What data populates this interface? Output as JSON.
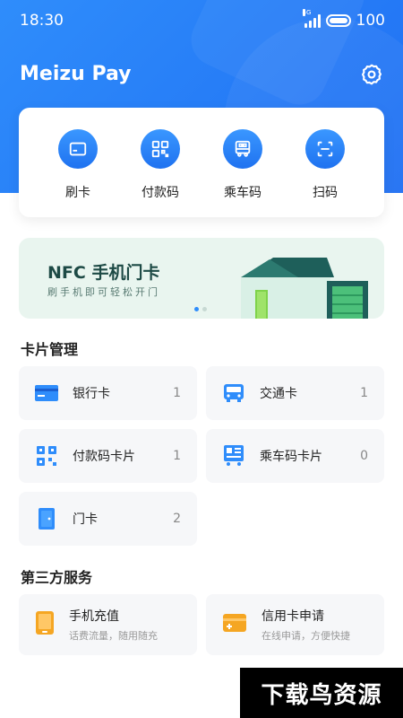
{
  "status_bar": {
    "time": "18:30",
    "network": "4G",
    "battery": "100"
  },
  "app": {
    "title": "Meizu Pay"
  },
  "quick_actions": [
    {
      "label": "刷卡",
      "icon": "card-swipe-icon"
    },
    {
      "label": "付款码",
      "icon": "qr-code-icon"
    },
    {
      "label": "乘车码",
      "icon": "bus-code-icon"
    },
    {
      "label": "扫码",
      "icon": "scan-icon"
    }
  ],
  "banner": {
    "title": "NFC 手机门卡",
    "subtitle": "刷手机即可轻松开门",
    "page_count": 2,
    "active_page": 1
  },
  "card_management": {
    "title": "卡片管理",
    "items": [
      {
        "label": "银行卡",
        "count": "1",
        "icon": "bank-card-icon"
      },
      {
        "label": "交通卡",
        "count": "1",
        "icon": "transit-card-icon"
      },
      {
        "label": "付款码卡片",
        "count": "1",
        "icon": "payment-code-icon"
      },
      {
        "label": "乘车码卡片",
        "count": "0",
        "icon": "ride-code-icon"
      },
      {
        "label": "门卡",
        "count": "2",
        "icon": "door-card-icon"
      }
    ]
  },
  "third_party": {
    "title": "第三方服务",
    "items": [
      {
        "title": "手机充值",
        "subtitle": "话费流量，随用随充",
        "icon": "phone-topup-icon"
      },
      {
        "title": "信用卡申请",
        "subtitle": "在线申请，方便快捷",
        "icon": "credit-card-icon"
      }
    ]
  },
  "watermark": "下载鸟资源",
  "colors": {
    "primary": "#2f8dfb",
    "banner_bg": "#e9f5ef",
    "tile_bg": "#f6f7f9",
    "topup_orange": "#f5a623"
  }
}
